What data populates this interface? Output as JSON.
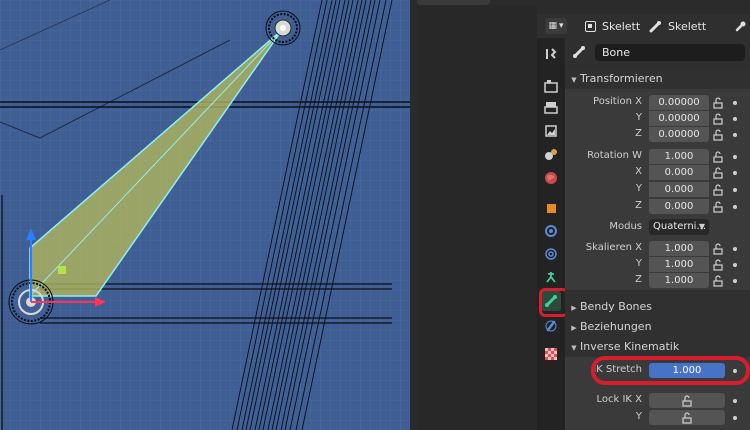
{
  "header": {
    "object_name": "Skelett",
    "data_name": "Skelett",
    "editor_type_icon": "properties-editor-icon"
  },
  "properties": {
    "active_tab": "bone",
    "bone_name": "Bone",
    "transform": {
      "title": "Transformieren",
      "position": {
        "label_x": "Position X",
        "label_y": "Y",
        "label_z": "Z",
        "x": "0.00000",
        "y": "0.00000",
        "z": "0.00000"
      },
      "rotation": {
        "label_w": "Rotation W",
        "label_x": "X",
        "label_y": "Y",
        "label_z": "Z",
        "w": "1.000",
        "x": "0.000",
        "y": "0.000",
        "z": "0.000"
      },
      "mode": {
        "label": "Modus",
        "value": "Quaterni..."
      },
      "scale": {
        "label_x": "Skalieren X",
        "label_y": "Y",
        "label_z": "Z",
        "x": "1.000",
        "y": "1.000",
        "z": "1.000"
      }
    },
    "panels": {
      "bendy_bones": "Bendy Bones",
      "relations": "Beziehungen",
      "inverse_kinematics": "Inverse Kinematik"
    },
    "ik": {
      "stretch_label": "IK Stretch",
      "stretch_value": "1.000",
      "lock_x_label": "Lock IK X",
      "lock_y_label": "Y"
    }
  },
  "tabs": [
    "tool-icon",
    "render-icon",
    "output-icon",
    "view-layer-icon",
    "scene-icon",
    "world-icon",
    "object-icon",
    "modifier-icon",
    "particles-icon",
    "physics-icon",
    "bone-icon",
    "bone-constraint-icon",
    "texture-icon"
  ],
  "colors": {
    "viewport_bg": "#3e5e94",
    "bone_fill": "#b5b85a",
    "bone_outline": "#8ef0f0",
    "highlight_red": "#d81e2c",
    "ik_field_blue": "#4773c6",
    "active_tab_green": "#3fd09a"
  }
}
